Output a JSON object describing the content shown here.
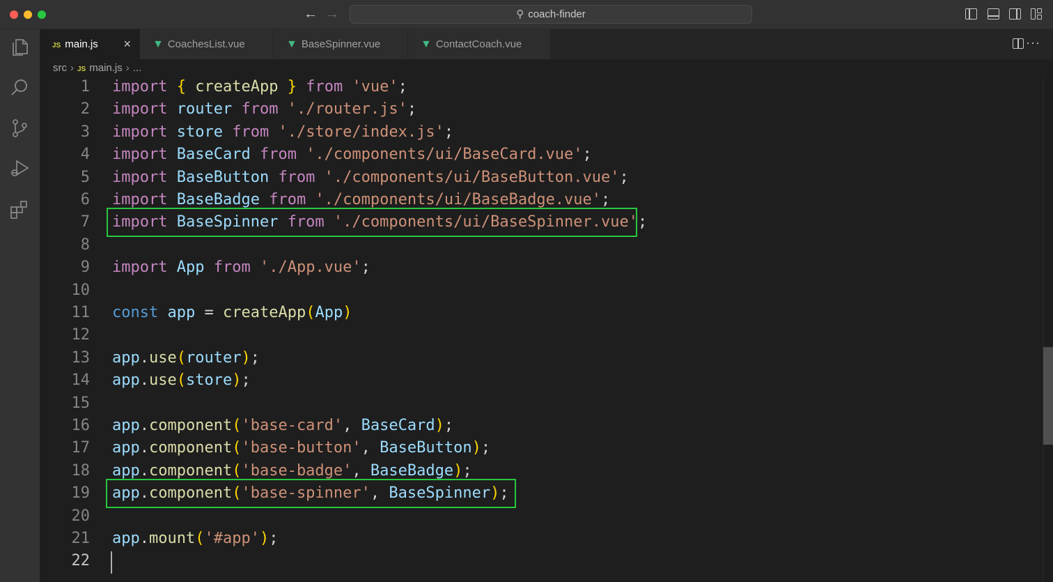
{
  "window": {
    "search_text": "coach-finder"
  },
  "tabs": [
    {
      "label": "main.js",
      "type": "js",
      "active": true
    },
    {
      "label": "CoachesList.vue",
      "type": "vue",
      "active": false
    },
    {
      "label": "BaseSpinner.vue",
      "type": "vue",
      "active": false
    },
    {
      "label": "ContactCoach.vue",
      "type": "vue",
      "active": false
    }
  ],
  "tab_close_glyph": "×",
  "breadcrumb": {
    "folder": "src",
    "file": "main.js",
    "more": "...",
    "file_badge": "JS"
  },
  "activity_icons": [
    "explorer-icon",
    "search-icon",
    "source-control-icon",
    "run-debug-icon",
    "extensions-icon"
  ],
  "editor": {
    "current_line": 22,
    "highlighted_lines": [
      7,
      19
    ],
    "highlight_color": "#28c840",
    "line_numbers": [
      "1",
      "2",
      "3",
      "4",
      "5",
      "6",
      "7",
      "8",
      "9",
      "10",
      "11",
      "12",
      "13",
      "14",
      "15",
      "16",
      "17",
      "18",
      "19",
      "20",
      "21",
      "22"
    ],
    "lines": [
      "import { createApp } from 'vue';",
      "import router from './router.js';",
      "import store from './store/index.js';",
      "import BaseCard from './components/ui/BaseCard.vue';",
      "import BaseButton from './components/ui/BaseButton.vue';",
      "import BaseBadge from './components/ui/BaseBadge.vue';",
      "import BaseSpinner from './components/ui/BaseSpinner.vue';",
      "",
      "import App from './App.vue';",
      "",
      "const app = createApp(App)",
      "",
      "app.use(router);",
      "app.use(store);",
      "",
      "app.component('base-card', BaseCard);",
      "app.component('base-button', BaseButton);",
      "app.component('base-badge', BaseBadge);",
      "app.component('base-spinner', BaseSpinner);",
      "",
      "app.mount('#app');",
      ""
    ]
  }
}
